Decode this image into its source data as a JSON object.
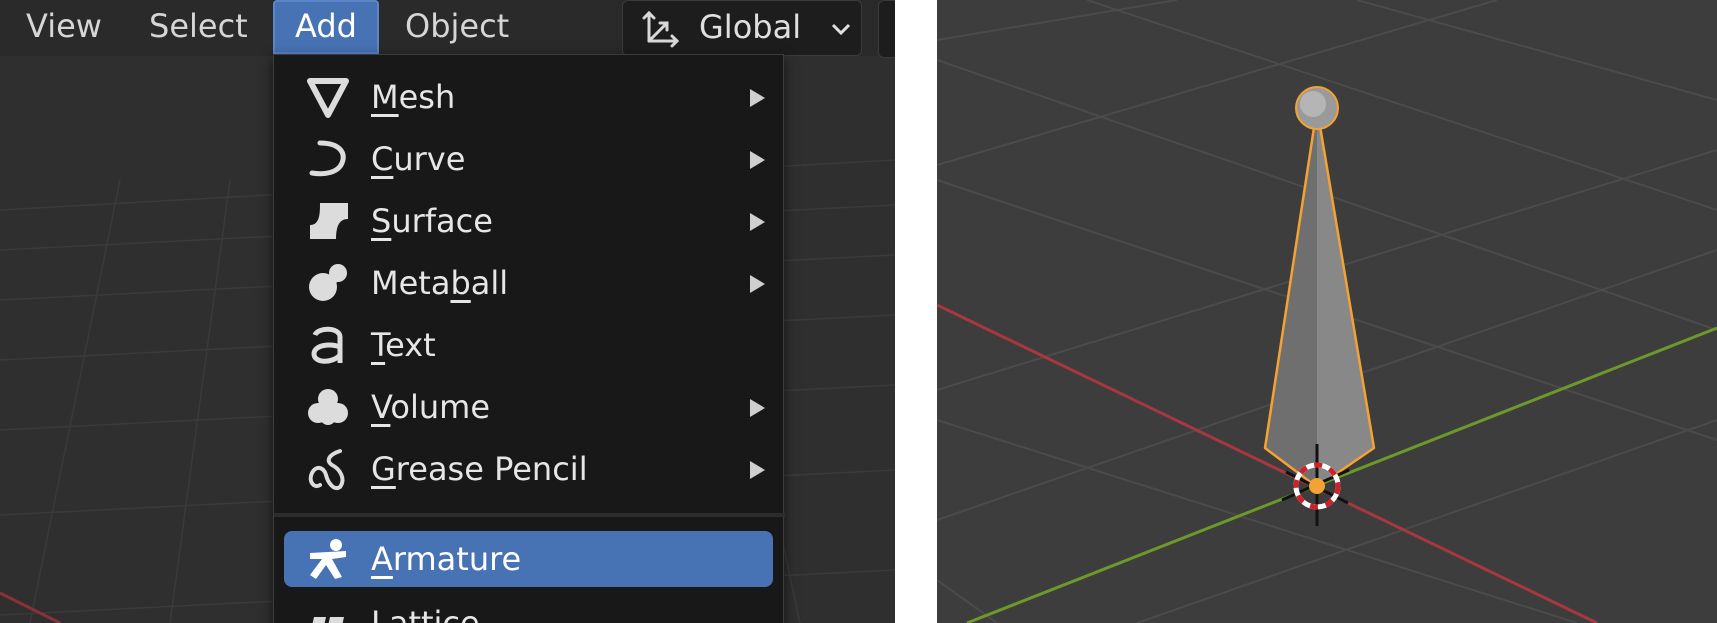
{
  "header": {
    "menus": [
      {
        "label": "View"
      },
      {
        "label": "Select"
      },
      {
        "label": "Add"
      },
      {
        "label": "Object"
      }
    ],
    "active_menu": "Add",
    "orientation": {
      "label": "Global",
      "icon": "transform-orientation-icon"
    }
  },
  "add_menu": {
    "items": [
      {
        "label": "Mesh",
        "underline_char": "M",
        "icon": "mesh-icon",
        "submenu": true
      },
      {
        "label": "Curve",
        "underline_char": "C",
        "icon": "curve-icon",
        "submenu": true
      },
      {
        "label": "Surface",
        "underline_char": "S",
        "icon": "surface-icon",
        "submenu": true
      },
      {
        "label": "Metaball",
        "underline_char": "b",
        "icon": "metaball-icon",
        "submenu": true
      },
      {
        "label": "Text",
        "underline_char": "T",
        "icon": "text-icon",
        "submenu": false
      },
      {
        "label": "Volume",
        "underline_char": "V",
        "icon": "volume-icon",
        "submenu": true
      },
      {
        "label": "Grease Pencil",
        "underline_char": "G",
        "icon": "grease-pencil-icon",
        "submenu": true
      },
      {
        "label": "Armature",
        "underline_char": "A",
        "icon": "armature-icon",
        "submenu": false,
        "highlighted": true
      },
      {
        "label": "Lattice",
        "underline_char": "L",
        "icon": "lattice-icon",
        "submenu": false
      }
    ]
  },
  "colors": {
    "accent": "#4772b3",
    "menu_bg": "#181818",
    "viewport_bg": "#3d3d3d",
    "x_axis": "#a8373f",
    "y_axis": "#6b9a2a",
    "selection": "#f4a233"
  }
}
